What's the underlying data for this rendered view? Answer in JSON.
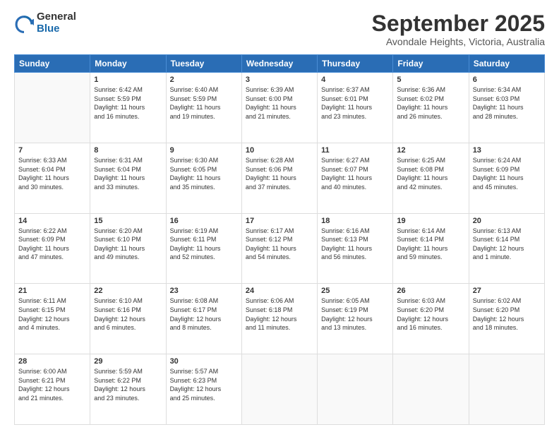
{
  "header": {
    "logo_general": "General",
    "logo_blue": "Blue",
    "month_title": "September 2025",
    "location": "Avondale Heights, Victoria, Australia"
  },
  "days_of_week": [
    "Sunday",
    "Monday",
    "Tuesday",
    "Wednesday",
    "Thursday",
    "Friday",
    "Saturday"
  ],
  "weeks": [
    [
      {
        "day": "",
        "detail": ""
      },
      {
        "day": "1",
        "detail": "Sunrise: 6:42 AM\nSunset: 5:59 PM\nDaylight: 11 hours\nand 16 minutes."
      },
      {
        "day": "2",
        "detail": "Sunrise: 6:40 AM\nSunset: 5:59 PM\nDaylight: 11 hours\nand 19 minutes."
      },
      {
        "day": "3",
        "detail": "Sunrise: 6:39 AM\nSunset: 6:00 PM\nDaylight: 11 hours\nand 21 minutes."
      },
      {
        "day": "4",
        "detail": "Sunrise: 6:37 AM\nSunset: 6:01 PM\nDaylight: 11 hours\nand 23 minutes."
      },
      {
        "day": "5",
        "detail": "Sunrise: 6:36 AM\nSunset: 6:02 PM\nDaylight: 11 hours\nand 26 minutes."
      },
      {
        "day": "6",
        "detail": "Sunrise: 6:34 AM\nSunset: 6:03 PM\nDaylight: 11 hours\nand 28 minutes."
      }
    ],
    [
      {
        "day": "7",
        "detail": "Sunrise: 6:33 AM\nSunset: 6:04 PM\nDaylight: 11 hours\nand 30 minutes."
      },
      {
        "day": "8",
        "detail": "Sunrise: 6:31 AM\nSunset: 6:04 PM\nDaylight: 11 hours\nand 33 minutes."
      },
      {
        "day": "9",
        "detail": "Sunrise: 6:30 AM\nSunset: 6:05 PM\nDaylight: 11 hours\nand 35 minutes."
      },
      {
        "day": "10",
        "detail": "Sunrise: 6:28 AM\nSunset: 6:06 PM\nDaylight: 11 hours\nand 37 minutes."
      },
      {
        "day": "11",
        "detail": "Sunrise: 6:27 AM\nSunset: 6:07 PM\nDaylight: 11 hours\nand 40 minutes."
      },
      {
        "day": "12",
        "detail": "Sunrise: 6:25 AM\nSunset: 6:08 PM\nDaylight: 11 hours\nand 42 minutes."
      },
      {
        "day": "13",
        "detail": "Sunrise: 6:24 AM\nSunset: 6:09 PM\nDaylight: 11 hours\nand 45 minutes."
      }
    ],
    [
      {
        "day": "14",
        "detail": "Sunrise: 6:22 AM\nSunset: 6:09 PM\nDaylight: 11 hours\nand 47 minutes."
      },
      {
        "day": "15",
        "detail": "Sunrise: 6:20 AM\nSunset: 6:10 PM\nDaylight: 11 hours\nand 49 minutes."
      },
      {
        "day": "16",
        "detail": "Sunrise: 6:19 AM\nSunset: 6:11 PM\nDaylight: 11 hours\nand 52 minutes."
      },
      {
        "day": "17",
        "detail": "Sunrise: 6:17 AM\nSunset: 6:12 PM\nDaylight: 11 hours\nand 54 minutes."
      },
      {
        "day": "18",
        "detail": "Sunrise: 6:16 AM\nSunset: 6:13 PM\nDaylight: 11 hours\nand 56 minutes."
      },
      {
        "day": "19",
        "detail": "Sunrise: 6:14 AM\nSunset: 6:14 PM\nDaylight: 11 hours\nand 59 minutes."
      },
      {
        "day": "20",
        "detail": "Sunrise: 6:13 AM\nSunset: 6:14 PM\nDaylight: 12 hours\nand 1 minute."
      }
    ],
    [
      {
        "day": "21",
        "detail": "Sunrise: 6:11 AM\nSunset: 6:15 PM\nDaylight: 12 hours\nand 4 minutes."
      },
      {
        "day": "22",
        "detail": "Sunrise: 6:10 AM\nSunset: 6:16 PM\nDaylight: 12 hours\nand 6 minutes."
      },
      {
        "day": "23",
        "detail": "Sunrise: 6:08 AM\nSunset: 6:17 PM\nDaylight: 12 hours\nand 8 minutes."
      },
      {
        "day": "24",
        "detail": "Sunrise: 6:06 AM\nSunset: 6:18 PM\nDaylight: 12 hours\nand 11 minutes."
      },
      {
        "day": "25",
        "detail": "Sunrise: 6:05 AM\nSunset: 6:19 PM\nDaylight: 12 hours\nand 13 minutes."
      },
      {
        "day": "26",
        "detail": "Sunrise: 6:03 AM\nSunset: 6:20 PM\nDaylight: 12 hours\nand 16 minutes."
      },
      {
        "day": "27",
        "detail": "Sunrise: 6:02 AM\nSunset: 6:20 PM\nDaylight: 12 hours\nand 18 minutes."
      }
    ],
    [
      {
        "day": "28",
        "detail": "Sunrise: 6:00 AM\nSunset: 6:21 PM\nDaylight: 12 hours\nand 21 minutes."
      },
      {
        "day": "29",
        "detail": "Sunrise: 5:59 AM\nSunset: 6:22 PM\nDaylight: 12 hours\nand 23 minutes."
      },
      {
        "day": "30",
        "detail": "Sunrise: 5:57 AM\nSunset: 6:23 PM\nDaylight: 12 hours\nand 25 minutes."
      },
      {
        "day": "",
        "detail": ""
      },
      {
        "day": "",
        "detail": ""
      },
      {
        "day": "",
        "detail": ""
      },
      {
        "day": "",
        "detail": ""
      }
    ]
  ]
}
